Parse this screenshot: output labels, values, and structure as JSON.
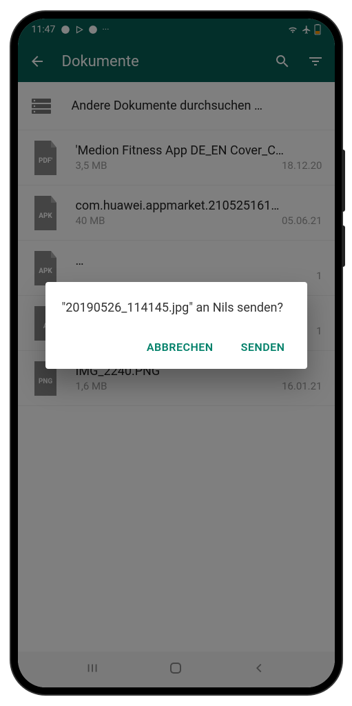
{
  "status": {
    "time": "11:47",
    "icons_left": [
      "●",
      "▷",
      "●",
      "···"
    ]
  },
  "header": {
    "title": "Dokumente"
  },
  "browse": {
    "text": "Andere Dokumente durchsuchen …"
  },
  "files": [
    {
      "icon": "PDF'",
      "name": "'Medion Fitness App DE_EN Cover_C…",
      "size": "3,5 MB",
      "date": "18.12.20"
    },
    {
      "icon": "APK",
      "name": "com.huawei.appmarket.210525161…",
      "size": "40 MB",
      "date": "05.06.21"
    },
    {
      "icon": "APK",
      "name": "…",
      "size": "",
      "date": "1"
    },
    {
      "icon": "A",
      "name": "…",
      "size": "",
      "date": "1"
    },
    {
      "icon": "PNG",
      "name": "IMG_2240.PNG",
      "size": "1,6 MB",
      "date": "16.01.21"
    }
  ],
  "dialog": {
    "message": "\"20190526_114145.jpg\" an Nils senden?",
    "cancel": "ABBRECHEN",
    "send": "SENDEN"
  },
  "colors": {
    "teal": "#075E54",
    "accent": "#008069"
  }
}
